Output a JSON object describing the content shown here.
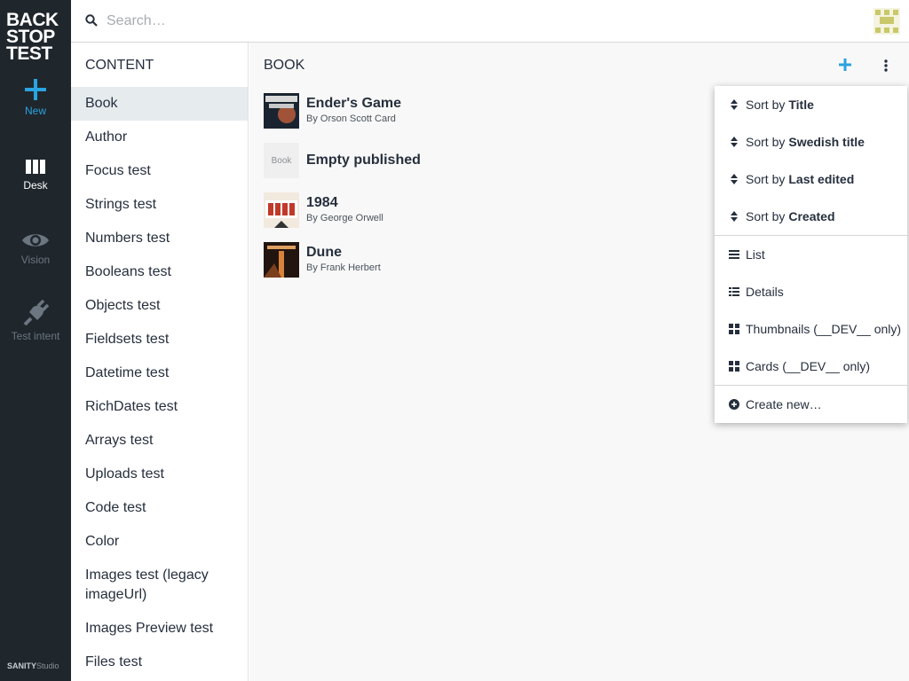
{
  "brand": {
    "line1": "BACK",
    "line2": "STOP",
    "line3": "TEST"
  },
  "sidenav": {
    "items": [
      {
        "label": "New",
        "icon": "plus-icon"
      },
      {
        "label": "Desk",
        "icon": "columns-icon"
      },
      {
        "label": "Vision",
        "icon": "eye-icon"
      },
      {
        "label": "Test intent",
        "icon": "plug-icon"
      }
    ],
    "footer_strong": "SANITY",
    "footer_light": "Studio"
  },
  "search": {
    "placeholder": "Search…"
  },
  "content": {
    "title": "CONTENT",
    "items": [
      "Book",
      "Author",
      "Focus test",
      "Strings test",
      "Numbers test",
      "Booleans test",
      "Objects test",
      "Fieldsets test",
      "Datetime test",
      "RichDates test",
      "Arrays test",
      "Uploads test",
      "Code test",
      "Color",
      "Images test (legacy imageUrl)",
      "Images Preview test",
      "Files test"
    ],
    "active": "Book"
  },
  "book": {
    "title": "BOOK",
    "documents": [
      {
        "title": "Ender's Game",
        "subtitle": "By Orson Scott Card",
        "thumb_text": "ENDER'S GAME"
      },
      {
        "title": "Empty published",
        "subtitle": "",
        "thumb_text": "Book"
      },
      {
        "title": "1984",
        "subtitle": "By George Orwell",
        "thumb_text": "1984"
      },
      {
        "title": "Dune",
        "subtitle": "By Frank Herbert",
        "thumb_text": "DUNE"
      }
    ]
  },
  "menu": {
    "sort_prefix": "Sort by",
    "sorts": [
      "Title",
      "Swedish title",
      "Last edited",
      "Created"
    ],
    "views": [
      "List",
      "Details",
      "Thumbnails (__DEV__ only)",
      "Cards (__DEV__ only)"
    ],
    "create": "Create new…"
  },
  "colors": {
    "nav_bg": "#1f262c",
    "accent": "#2aa3e0",
    "active_row": "#e6ebee"
  }
}
